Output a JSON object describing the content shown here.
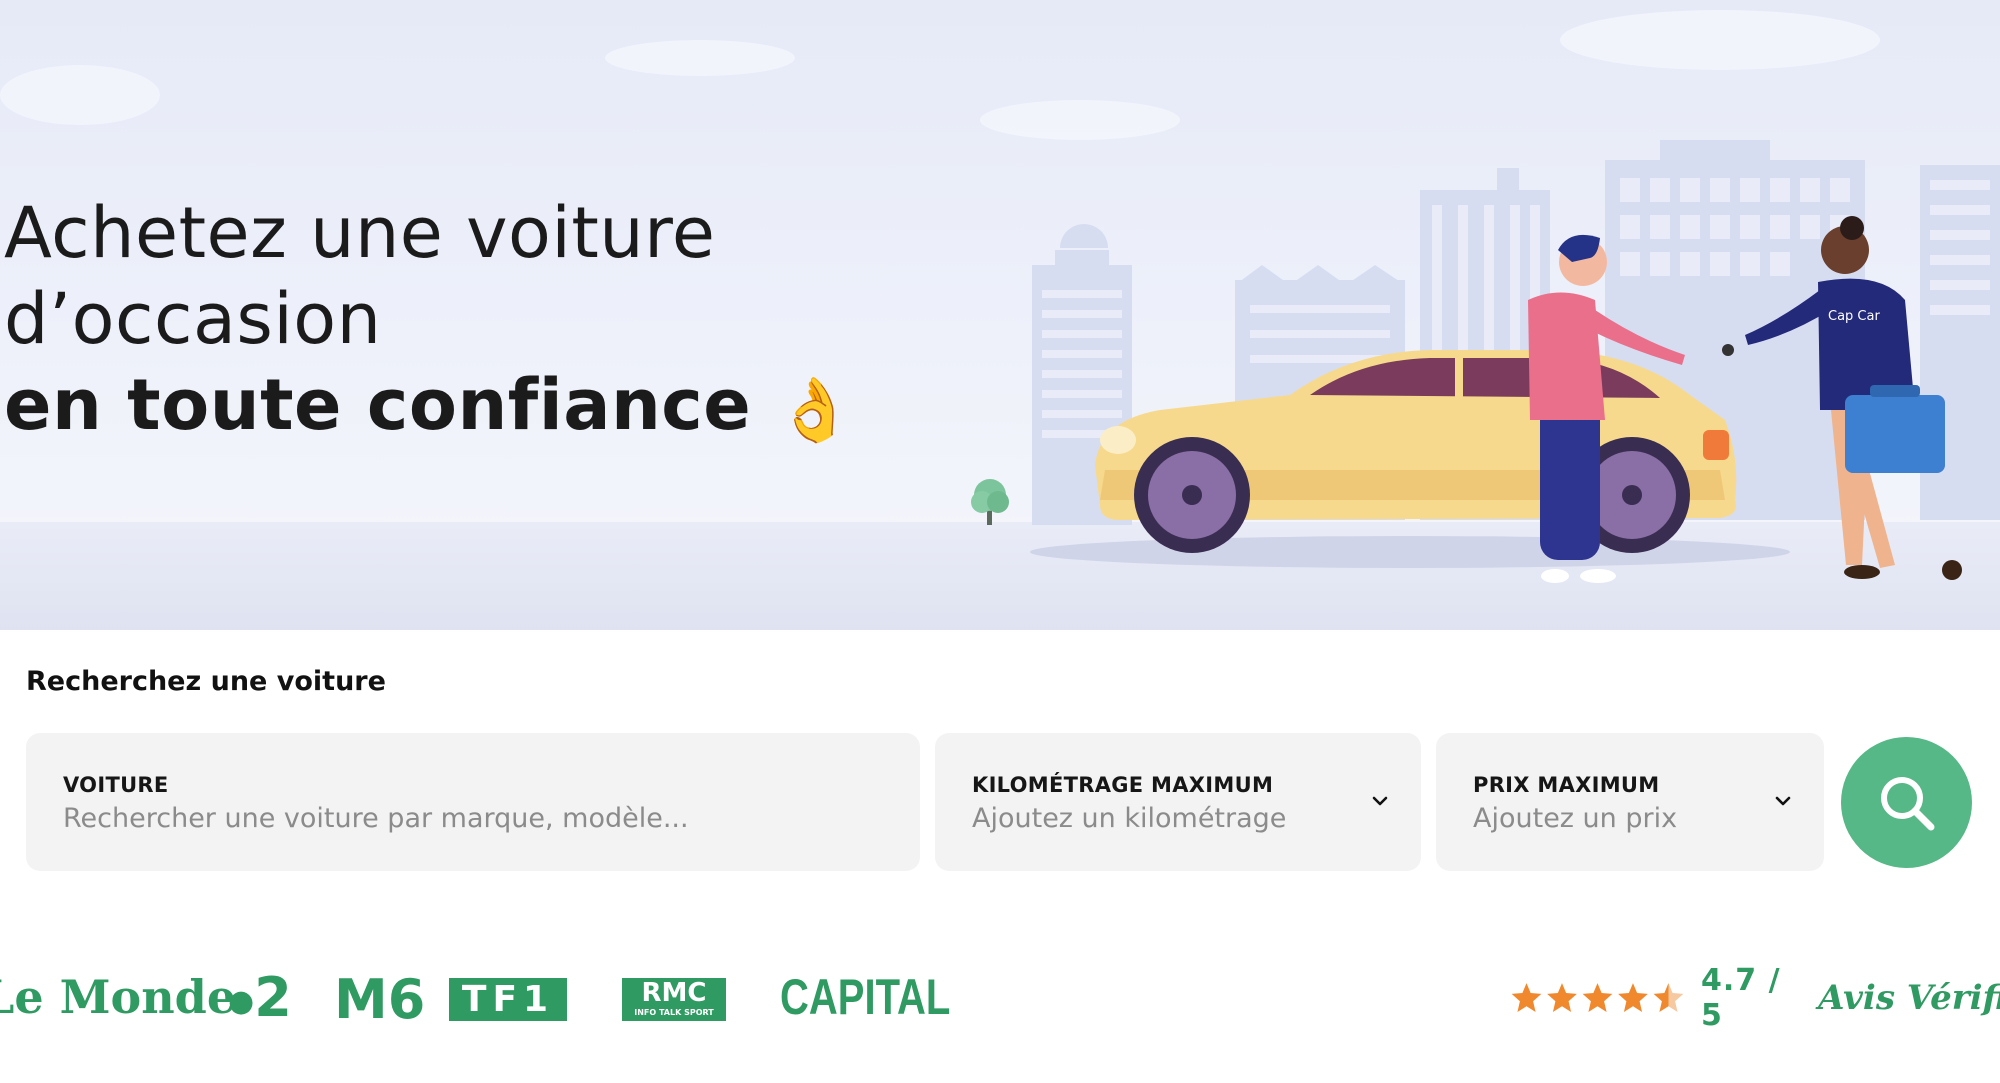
{
  "hero": {
    "line1": "Achetez une voiture",
    "line2": "d’occasion",
    "line3": "en toute confiance",
    "emoji": "👌",
    "brand_badge": "Cap Car"
  },
  "search": {
    "title": "Recherchez une voiture",
    "car": {
      "label": "VOITURE",
      "placeholder": "Rechercher une voiture par marque, modèle..."
    },
    "mileage": {
      "label": "KILOMÉTRAGE MAXIMUM",
      "placeholder": "Ajoutez un kilométrage"
    },
    "price": {
      "label": "PRIX MAXIMUM",
      "placeholder": "Ajoutez un prix"
    },
    "button_icon": "search-icon"
  },
  "media": {
    "logos": [
      "Le Monde",
      "2",
      "M6",
      "TF1",
      "RMC",
      "CAPITAL"
    ],
    "rmc_sub": "INFO TALK SPORT",
    "rating_value": "4.7 / 5",
    "rating_stars": 4.5,
    "rating_source": "Avis Vérifiés"
  },
  "colors": {
    "accent_green": "#55b886",
    "logo_green": "#2f9a62",
    "star_orange": "#f0892d",
    "hero_bg": "#e9ecf7"
  }
}
